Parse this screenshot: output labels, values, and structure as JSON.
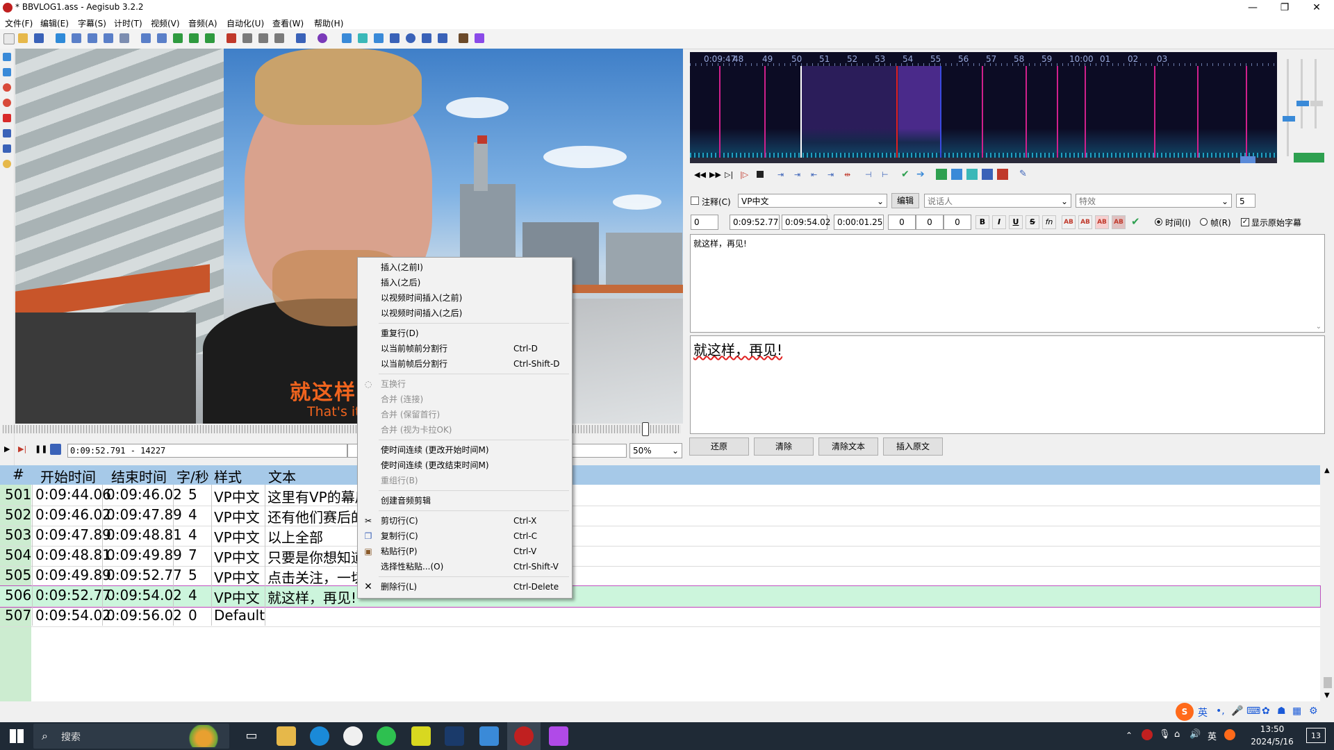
{
  "window": {
    "title": "* BBVLOG1.ass - Aegisub 3.2.2",
    "controls": [
      "—",
      "❐",
      "✕"
    ]
  },
  "menubar": [
    "文件(F)",
    "编辑(E)",
    "字幕(S)",
    "计时(T)",
    "视频(V)",
    "音频(A)",
    "自动化(U)",
    "查看(W)",
    "帮助(H)"
  ],
  "video": {
    "subtitle_cn": "就这样，",
    "subtitle_en": "That's it",
    "time_display": "0:09:52.791 - 14227",
    "zoom": "50%"
  },
  "audio": {
    "ruler_labels": [
      "0:09:47",
      "48",
      "49",
      "50",
      "51",
      "52",
      "53",
      "54",
      "55",
      "56",
      "57",
      "58",
      "59",
      "10:00",
      "01",
      "02",
      "03"
    ]
  },
  "edit": {
    "comment_label": "注释(C)",
    "style": "VP中文",
    "edit_button": "编辑",
    "actor_placeholder": "说话人",
    "effect_placeholder": "特效",
    "line_count": "5",
    "layer": "0",
    "start_time": "0:09:52.77",
    "end_time": "0:09:54.02",
    "duration": "0:00:01.25",
    "margin_l": "0",
    "margin_r": "0",
    "margin_v": "0",
    "fmt_bold": "B",
    "fmt_italic": "I",
    "fmt_underline": "U",
    "fmt_strike": "S",
    "fmt_fn": "fn",
    "fmt_ab": "AB",
    "time_radio": "时间(I)",
    "frame_radio": "帧(R)",
    "show_original": "显示原始字幕",
    "text": "就这样，再见!",
    "preview_text": "就这样，再见!",
    "buttons": [
      "还原",
      "清除",
      "清除文本",
      "插入原文"
    ]
  },
  "grid": {
    "headers": [
      "#",
      "开始时间",
      "结束时间",
      "字/秒",
      "样式",
      "文本"
    ],
    "rows": [
      [
        "501",
        "0:09:44.06",
        "0:09:46.02",
        "5",
        "VP中文",
        "这里有VP的幕后"
      ],
      [
        "502",
        "0:09:46.02",
        "0:09:47.89",
        "4",
        "VP中文",
        "还有他们赛后的"
      ],
      [
        "503",
        "0:09:47.89",
        "0:09:48.81",
        "4",
        "VP中文",
        "以上全部"
      ],
      [
        "504",
        "0:09:48.81",
        "0:09:49.89",
        "7",
        "VP中文",
        "只要是你想知道"
      ],
      [
        "505",
        "0:09:49.89",
        "0:09:52.77",
        "5",
        "VP中文",
        "点击关注，一切"
      ],
      [
        "506",
        "0:09:52.77",
        "0:09:54.02",
        "4",
        "VP中文",
        "就这样，再见!"
      ],
      [
        "507",
        "0:09:54.02",
        "0:09:56.02",
        "0",
        "Default",
        ""
      ]
    ]
  },
  "context_menu": [
    {
      "label": "插入(之前I)",
      "shortcut": "",
      "disabled": false
    },
    {
      "label": "插入(之后)",
      "shortcut": "",
      "disabled": false
    },
    {
      "label": "以视频时间插入(之前)",
      "shortcut": "",
      "disabled": false
    },
    {
      "label": "以视频时间插入(之后)",
      "shortcut": "",
      "disabled": false
    },
    {
      "label": "重复行(D)",
      "shortcut": "",
      "disabled": false
    },
    {
      "label": "以当前帧前分割行",
      "shortcut": "Ctrl-D",
      "disabled": false
    },
    {
      "label": "以当前帧后分割行",
      "shortcut": "Ctrl-Shift-D",
      "disabled": false
    },
    {
      "label": "互换行",
      "shortcut": "",
      "disabled": true
    },
    {
      "label": "合并 (连接)",
      "shortcut": "",
      "disabled": true
    },
    {
      "label": "合并 (保留首行)",
      "shortcut": "",
      "disabled": true
    },
    {
      "label": "合并 (视为卡拉OK)",
      "shortcut": "",
      "disabled": true
    },
    {
      "label": "使时间连续 (更改开始时间M)",
      "shortcut": "",
      "disabled": false
    },
    {
      "label": "使时间连续 (更改结束时间M)",
      "shortcut": "",
      "disabled": false
    },
    {
      "label": "重组行(B)",
      "shortcut": "",
      "disabled": true
    },
    {
      "label": "创建音频剪辑",
      "shortcut": "",
      "disabled": false
    },
    {
      "label": "剪切行(C)",
      "shortcut": "Ctrl-X",
      "disabled": false
    },
    {
      "label": "复制行(C)",
      "shortcut": "Ctrl-C",
      "disabled": false
    },
    {
      "label": "粘贴行(P)",
      "shortcut": "Ctrl-V",
      "disabled": false
    },
    {
      "label": "选择性粘贴...(O)",
      "shortcut": "Ctrl-Shift-V",
      "disabled": false
    },
    {
      "label": "删除行(L)",
      "shortcut": "Ctrl-Delete",
      "disabled": false
    }
  ],
  "ime": {
    "lang": "英",
    "tray_lang": "英"
  },
  "taskbar": {
    "search_placeholder": "搜索",
    "time": "13:50",
    "date": "2024/5/16",
    "notifications": "13"
  }
}
